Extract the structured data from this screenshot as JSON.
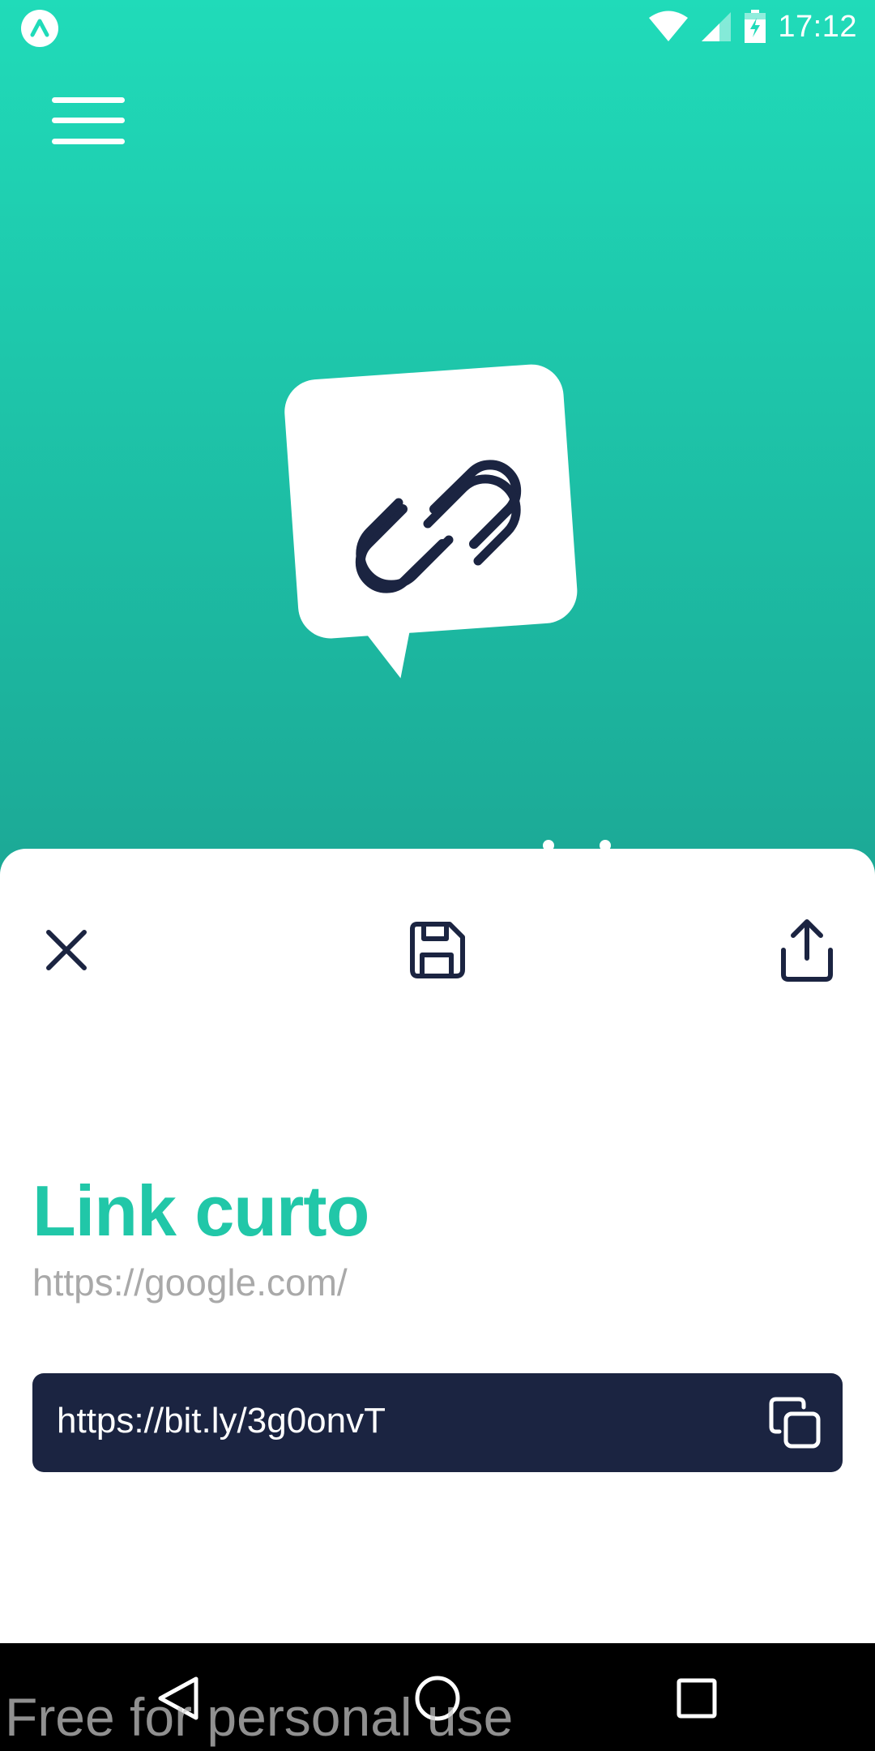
{
  "status_bar": {
    "time": "17:12",
    "icons": [
      "app-notification-icon",
      "wifi-icon",
      "cell-signal-icon",
      "battery-charging-icon"
    ]
  },
  "header": {
    "menu_icon": "hamburger-menu-icon"
  },
  "hero": {
    "logo_icon": "chat-bubble-link-icon"
  },
  "sheet": {
    "actions": [
      "close-icon",
      "save-icon",
      "share-icon"
    ],
    "title": "Link curto",
    "original_url": "https://google.com/",
    "short_url": "https://bit.ly/3g0onvT",
    "copy_icon": "copy-icon"
  },
  "nav_bar": {
    "icons": [
      "back-icon",
      "home-icon",
      "recent-apps-icon"
    ]
  },
  "watermark": "Free for personal use",
  "colors": {
    "gradient_top": "#20dbb9",
    "gradient_bottom": "#1a7f79",
    "accent": "#21c7a8",
    "dark": "#1b2441",
    "muted_text": "#a9a9a9"
  }
}
